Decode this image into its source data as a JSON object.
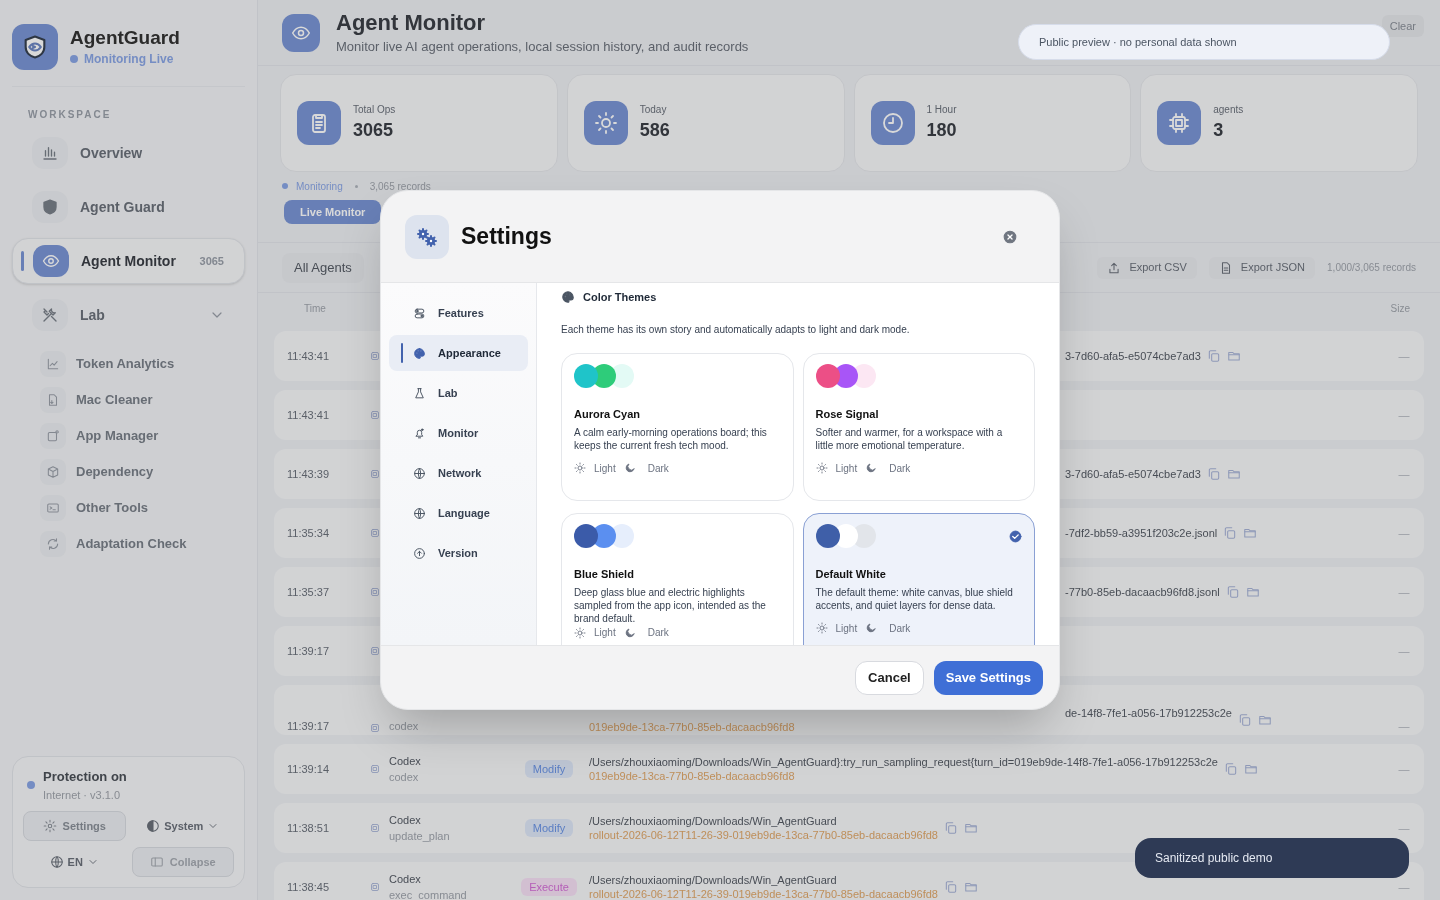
{
  "brand": {
    "name": "AgentGuard",
    "status": "Monitoring Live"
  },
  "sidebar": {
    "section": "WORKSPACE",
    "items": [
      {
        "label": "Overview",
        "selected": false
      },
      {
        "label": "Agent Guard",
        "selected": false
      },
      {
        "label": "Agent Monitor",
        "selected": true,
        "count": "3065"
      },
      {
        "label": "Lab",
        "selected": false,
        "expanded": true,
        "children": [
          {
            "label": "Token Analytics"
          },
          {
            "label": "Mac Cleaner"
          },
          {
            "label": "App Manager"
          },
          {
            "label": "Dependency"
          },
          {
            "label": "Other Tools"
          },
          {
            "label": "Adaptation Check"
          }
        ]
      }
    ]
  },
  "footer_card": {
    "title": "Protection on",
    "subtitle": "Internet · v3.1.0",
    "settings_button": "Settings",
    "theme_select": "System",
    "language_select": "EN",
    "collapse_button": "Collapse"
  },
  "header": {
    "title": "Agent Monitor",
    "subtitle": "Monitor live AI agent operations, local session history, and audit records",
    "clear_button": "Clear"
  },
  "stats": [
    {
      "label": "Total Ops",
      "value": "3065"
    },
    {
      "label": "Today",
      "value": "586"
    },
    {
      "label": "1 Hour",
      "value": "180"
    },
    {
      "label": "agents",
      "value": "3"
    }
  ],
  "status_line": {
    "state": "Monitoring",
    "records": "3,065 records"
  },
  "tabs": [
    {
      "label": "Live Monitor",
      "selected": true
    }
  ],
  "filter_bar": {
    "agent_select": "All Agents",
    "export_csv": "Export CSV",
    "export_json": "Export JSON",
    "count": "1,000/3,065 records"
  },
  "table": {
    "columns": [
      "Time",
      "Size"
    ],
    "rows": [
      {
        "kind": "covered",
        "time": "11:43:41",
        "path": "3-7d60-afa5-e5074cbe7ad3",
        "size": "—"
      },
      {
        "kind": "covered",
        "time": "11:43:41",
        "size": "—"
      },
      {
        "kind": "covered",
        "time": "11:43:39",
        "path": "3-7d60-afa5-e5074cbe7ad3",
        "size": "—"
      },
      {
        "kind": "covered",
        "time": "11:35:34",
        "path": "-7df2-bb59-a3951f203c2e.jsonl",
        "size": "—"
      },
      {
        "kind": "covered",
        "time": "11:35:37",
        "path": "-77b0-85eb-dacaacb96fd8.jsonl",
        "size": "—"
      },
      {
        "kind": "covered",
        "time": "11:39:17",
        "size": "—"
      },
      {
        "kind": "partial",
        "time": "11:39:17",
        "tool": "codex",
        "path": "de-14f8-7fe1-a056-17b912253c2e",
        "file": "019eb9de-13ca-77b0-85eb-dacaacb96fd8",
        "size": "—"
      },
      {
        "kind": "full",
        "time": "11:39:14",
        "agent": "Codex",
        "tool": "codex",
        "action": {
          "label": "Modify",
          "kind": "modify"
        },
        "path": "/Users/zhouxiaoming/Downloads/Win_AgentGuard}:try_run_sampling_request{turn_id=019eb9de-14f8-7fe1-a056-17b912253c2e",
        "file": "019eb9de-13ca-77b0-85eb-dacaacb96fd8",
        "size": "—"
      },
      {
        "kind": "full",
        "time": "11:38:51",
        "agent": "Codex",
        "tool": "update_plan",
        "action": {
          "label": "Modify",
          "kind": "modify"
        },
        "path": "/Users/zhouxiaoming/Downloads/Win_AgentGuard",
        "file": "rollout-2026-06-12T11-26-39-019eb9de-13ca-77b0-85eb-dacaacb96fd8",
        "size": "—"
      },
      {
        "kind": "full",
        "time": "11:38:45",
        "agent": "Codex",
        "tool": "exec_command",
        "action": {
          "label": "Execute",
          "kind": "execute"
        },
        "path": "/Users/zhouxiaoming/Downloads/Win_AgentGuard",
        "file": "rollout-2026-06-12T11-26-39-019eb9de-13ca-77b0-85eb-dacaacb96fd8",
        "size": "—"
      }
    ]
  },
  "settings_dialog": {
    "title": "Settings",
    "nav": [
      {
        "label": "Features",
        "selected": false
      },
      {
        "label": "Appearance",
        "selected": true
      },
      {
        "label": "Lab",
        "selected": false
      },
      {
        "label": "Monitor",
        "selected": false
      },
      {
        "label": "Network",
        "selected": false
      },
      {
        "label": "Language",
        "selected": false
      },
      {
        "label": "Version",
        "selected": false
      }
    ],
    "section_title": "Color Themes",
    "section_description": "Each theme has its own story and automatically adapts to light and dark mode.",
    "themes": [
      {
        "name": "Aurora Cyan",
        "description": "A calm early-morning operations board; this keeps the current fresh tech mood.",
        "swatches": [
          {
            "color": "#1fc4c9"
          },
          {
            "color": "#2ecc7a"
          },
          {
            "color": "#e3faf5"
          }
        ],
        "light": "Light",
        "dark": "Dark",
        "selected": false
      },
      {
        "name": "Rose Signal",
        "description": "Softer and warmer, for a workspace with a little more emotional temperature.",
        "swatches": [
          {
            "color": "#ec4f86"
          },
          {
            "color": "#a855f7"
          },
          {
            "color": "#fce7f3"
          }
        ],
        "light": "Light",
        "dark": "Dark",
        "selected": false
      },
      {
        "name": "Blue Shield",
        "description": "Deep glass blue and electric highlights sampled from the app icon, intended as the brand default.",
        "swatches": [
          {
            "color": "#3b5ba9"
          },
          {
            "color": "#5b8ff0"
          },
          {
            "color": "#e6eefc"
          }
        ],
        "light": "Light",
        "dark": "Dark",
        "selected": false
      },
      {
        "name": "Default White",
        "description": "The default theme: white canvas, blue shield accents, and quiet layers for dense data.",
        "swatches": [
          {
            "color": "#3f5fa8"
          },
          {
            "color": "#ffffff"
          },
          {
            "color": "#e2e5ea"
          }
        ],
        "light": "Light",
        "dark": "Dark",
        "selected": true
      }
    ],
    "cancel_button": "Cancel",
    "save_button": "Save Settings"
  },
  "toasts": [
    {
      "kind": "light",
      "text": "Public preview · no personal data shown"
    },
    {
      "kind": "dark",
      "text": "Sanitized public demo"
    }
  ]
}
